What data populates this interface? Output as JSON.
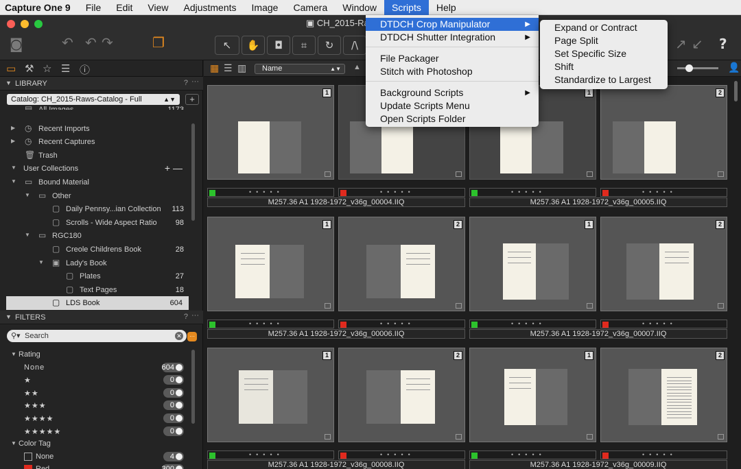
{
  "menubar": {
    "app": "Capture One 9",
    "items": [
      "File",
      "Edit",
      "View",
      "Adjustments",
      "Image",
      "Camera",
      "Window",
      "Scripts",
      "Help"
    ],
    "active": "Scripts"
  },
  "window": {
    "title": "CH_2015-Raw"
  },
  "scripts_menu": {
    "items": [
      {
        "label": "DTDCH Crop Manipulator",
        "submenu": true,
        "highlighted": true
      },
      {
        "label": "DTDCH Shutter Integration",
        "submenu": true
      },
      {
        "label": "File Packager"
      },
      {
        "label": "Stitch with Photoshop"
      },
      {
        "label": "Background Scripts",
        "submenu": true
      },
      {
        "label": "Update Scripts Menu"
      },
      {
        "label": "Open Scripts Folder"
      }
    ]
  },
  "crop_submenu": {
    "items": [
      "Expand or Contract",
      "Page Split",
      "Set Specific Size",
      "Shift",
      "Standardize to Largest"
    ]
  },
  "library": {
    "header": "LIBRARY",
    "help": "?",
    "more": "···",
    "catalog": "Catalog: CH_2015-Raws-Catalog - Full",
    "add": "+",
    "tree": [
      {
        "label": "All Images",
        "count": "1173",
        "indent": 0,
        "icon": "images-icon",
        "clipped": true
      },
      {
        "label": "Recent Imports",
        "indent": 0,
        "icon": "clock-icon",
        "arrow": "▶"
      },
      {
        "label": "Recent Captures",
        "indent": 0,
        "icon": "clock-icon",
        "arrow": "▶"
      },
      {
        "label": "Trash",
        "indent": 0,
        "icon": "trash-icon"
      },
      {
        "label": "User Collections",
        "indent": -1,
        "arrow": "▼",
        "actions": "+ —"
      },
      {
        "label": "Bound Material",
        "indent": 0,
        "icon": "folder-icon",
        "arrow": "▼"
      },
      {
        "label": "Other",
        "indent": 1,
        "icon": "folder-icon",
        "arrow": "▼"
      },
      {
        "label": "Daily Pennsy...ian Collection",
        "count": "113",
        "indent": 2,
        "icon": "album-icon"
      },
      {
        "label": "Scrolls - Wide Aspect Ratio",
        "count": "98",
        "indent": 2,
        "icon": "album-icon"
      },
      {
        "label": "RGC180",
        "indent": 1,
        "icon": "folder-icon",
        "arrow": "▼"
      },
      {
        "label": "Creole Childrens Book",
        "count": "28",
        "indent": 2,
        "icon": "album-icon"
      },
      {
        "label": "Lady's Book",
        "indent": 2,
        "icon": "project-icon",
        "arrow": "▼"
      },
      {
        "label": "Plates",
        "count": "27",
        "indent": 3,
        "icon": "album-icon"
      },
      {
        "label": "Text Pages",
        "count": "18",
        "indent": 3,
        "icon": "album-icon"
      },
      {
        "label": "LDS Book",
        "count": "604",
        "indent": 2,
        "icon": "album-icon",
        "selected": true
      }
    ]
  },
  "filters": {
    "header": "FILTERS",
    "help": "?",
    "more": "···",
    "search_placeholder": "Search",
    "rating_label": "Rating",
    "ratings": [
      {
        "label": "None",
        "count": "604"
      },
      {
        "label": "★",
        "count": "0"
      },
      {
        "label": "★★",
        "count": "0"
      },
      {
        "label": "★★★",
        "count": "0"
      },
      {
        "label": "★★★★",
        "count": "0"
      },
      {
        "label": "★★★★★",
        "count": "0"
      }
    ],
    "color_tag_label": "Color Tag",
    "color_tags": [
      {
        "label": "None",
        "count": "4",
        "color": "none"
      },
      {
        "label": "Red",
        "count": "300",
        "color": "#e02a1e"
      }
    ]
  },
  "browser": {
    "sort": "Name",
    "rows": [
      {
        "name": "M257.36 A1 1928-1972_v36g_00004.IIQ",
        "name2": "M257.36 A1 1928-1972_v36g_00005.IIQ",
        "cells": [
          {
            "num": "1",
            "flag": "#2cc22c",
            "dim": false
          },
          {
            "num": "2",
            "flag": "#e02a1e",
            "dim": true
          },
          {
            "num": "1",
            "flag": "#2cc22c",
            "dim": true
          },
          {
            "num": "2",
            "flag": "#e02a1e",
            "dim": false
          }
        ]
      },
      {
        "name": "M257.36 A1 1928-1972_v36g_00006.IIQ",
        "name2": "M257.36 A1 1928-1972_v36g_00007.IIQ",
        "cells": [
          {
            "num": "1",
            "flag": "#2cc22c"
          },
          {
            "num": "2",
            "flag": "#e02a1e"
          },
          {
            "num": "1",
            "flag": "#2cc22c"
          },
          {
            "num": "2",
            "flag": "#e02a1e"
          }
        ]
      },
      {
        "name": "M257.36 A1 1928-1972_v36g_00008.IIQ",
        "name2": "M257.36 A1 1928-1972_v36g_00009.IIQ",
        "cells": [
          {
            "num": "1",
            "flag": "#2cc22c"
          },
          {
            "num": "2",
            "flag": "#e02a1e"
          },
          {
            "num": "1",
            "flag": "#2cc22c"
          },
          {
            "num": "2",
            "flag": "#e02a1e"
          }
        ]
      }
    ],
    "rating_dots": "•••••"
  },
  "colors": {
    "accent": "#2f6fd6",
    "flag_green": "#2cc22c",
    "flag_red": "#e02a1e",
    "orange": "#e58a1f"
  }
}
